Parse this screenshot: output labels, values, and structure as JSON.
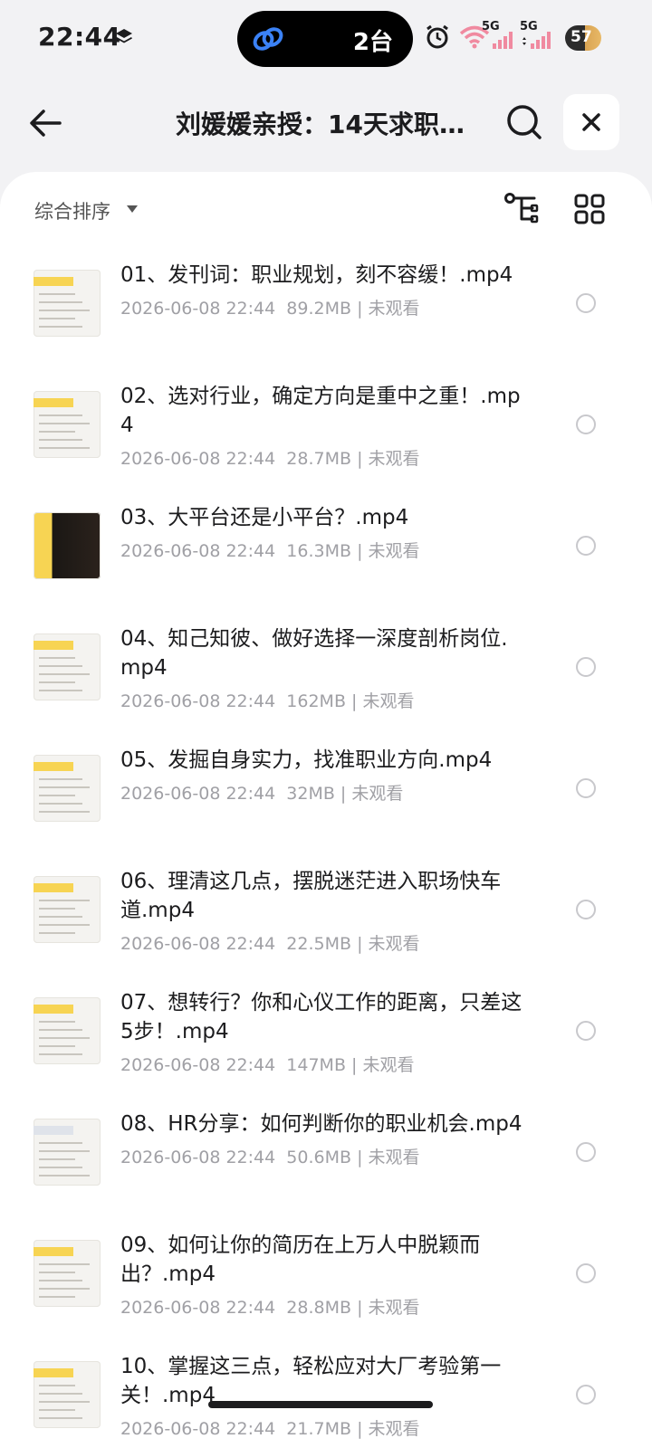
{
  "status": {
    "time": "22:44",
    "island_count": "2台",
    "sim1": "5G",
    "sim2": "5G",
    "battery": "57"
  },
  "header": {
    "title": "刘媛媛亲授：14天求职…",
    "back_icon": "back-arrow-icon",
    "search_icon": "search-icon",
    "close_icon": "close-icon"
  },
  "sortbar": {
    "sort_label": "综合排序"
  },
  "files": [
    {
      "name": "01、发刊词：职业规划，刻不容缓！.mp4",
      "meta": "2026-06-08 22:44  89.2MB | 未观看"
    },
    {
      "name": "02、选对行业，确定方向是重中之重！.mp4",
      "meta": "2026-06-08 22:44  28.7MB | 未观看"
    },
    {
      "name": "03、大平台还是小平台？.mp4",
      "meta": "2026-06-08 22:44  16.3MB | 未观看"
    },
    {
      "name": "04、知己知彼、做好选择一深度剖析岗位.mp4",
      "meta": "2026-06-08 22:44  162MB | 未观看"
    },
    {
      "name": "05、发掘自身实力，找准职业方向.mp4",
      "meta": "2026-06-08 22:44  32MB | 未观看"
    },
    {
      "name": "06、理清这几点，摆脱迷茫进入职场快车道.mp4",
      "meta": "2026-06-08 22:44  22.5MB | 未观看"
    },
    {
      "name": "07、想转行？你和心仪工作的距离，只差这5步！.mp4",
      "meta": "2026-06-08 22:44  147MB | 未观看"
    },
    {
      "name": "08、HR分享：如何判断你的职业机会.mp4",
      "meta": "2026-06-08 22:44  50.6MB | 未观看"
    },
    {
      "name": "09、如何让你的简历在上万人中脱颖而出？.mp4",
      "meta": "2026-06-08 22:44  28.8MB | 未观看"
    },
    {
      "name": "10、掌握这三点，轻松应对大厂考验第一关！.mp4",
      "meta": "2026-06-08 22:44  21.7MB | 未观看"
    }
  ],
  "colors": {
    "background": "#f2f2f4",
    "card": "#ffffff",
    "meta_text": "#a0a0a5",
    "accent_link": "#2f6bff"
  }
}
